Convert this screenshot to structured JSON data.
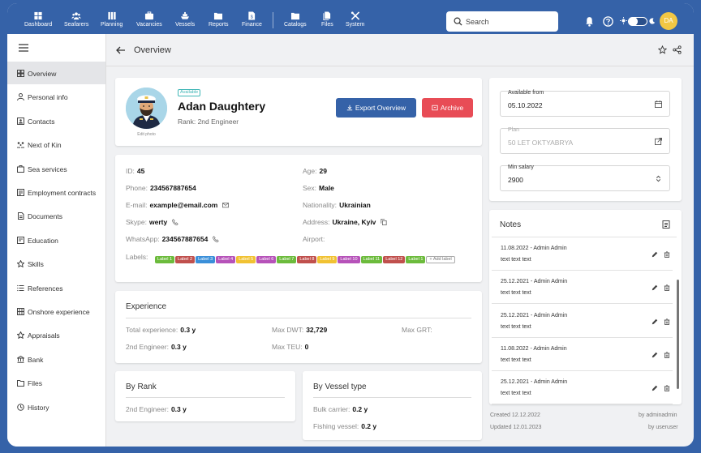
{
  "nav": [
    {
      "label": "Dashboard",
      "icon": "dashboard-icon"
    },
    {
      "label": "Seafarers",
      "icon": "people-icon"
    },
    {
      "label": "Planning",
      "icon": "planning-icon"
    },
    {
      "label": "Vacancies",
      "icon": "briefcase-icon"
    },
    {
      "label": "Vessels",
      "icon": "ship-icon"
    },
    {
      "label": "Reports",
      "icon": "reports-icon"
    },
    {
      "label": "Finance",
      "icon": "finance-icon"
    },
    {
      "label": "Catalogs",
      "icon": "folder-icon"
    },
    {
      "label": "Files",
      "icon": "files-icon"
    },
    {
      "label": "System",
      "icon": "tools-icon"
    }
  ],
  "search": {
    "placeholder": "Search"
  },
  "user": {
    "initials": "DA"
  },
  "sidebar": {
    "items": [
      {
        "label": "Overview",
        "icon": "grid-icon"
      },
      {
        "label": "Personal info",
        "icon": "person-icon"
      },
      {
        "label": "Contacts",
        "icon": "contacts-icon"
      },
      {
        "label": "Next of Kin",
        "icon": "family-icon"
      },
      {
        "label": "Sea services",
        "icon": "sea-services-icon"
      },
      {
        "label": "Employment contracts",
        "icon": "contract-icon"
      },
      {
        "label": "Documents",
        "icon": "documents-icon"
      },
      {
        "label": "Education",
        "icon": "education-icon"
      },
      {
        "label": "Skills",
        "icon": "skills-icon"
      },
      {
        "label": "References",
        "icon": "list-icon"
      },
      {
        "label": "Onshore experience",
        "icon": "building-icon"
      },
      {
        "label": "Appraisals",
        "icon": "star-icon"
      },
      {
        "label": "Bank",
        "icon": "bank-icon"
      },
      {
        "label": "Files",
        "icon": "folder-icon"
      },
      {
        "label": "History",
        "icon": "history-icon"
      }
    ]
  },
  "header": {
    "title": "Overview"
  },
  "profile": {
    "status": "Available",
    "name": "Adan Daughtery",
    "rank": "Rank: 2nd Engineer",
    "photo_caption": "Edit photo",
    "export_label": "Export Overview",
    "archive_label": "Archive"
  },
  "info": {
    "id_label": "ID:",
    "id_value": "45",
    "phone_label": "Phone:",
    "phone_value": "234567887654",
    "email_label": "E-mail:",
    "email_value": "example@email.com",
    "skype_label": "Skype:",
    "skype_value": "werty",
    "whatsapp_label": "WhatsApp:",
    "whatsapp_value": "234567887654",
    "age_label": "Age:",
    "age_value": "29",
    "sex_label": "Sex:",
    "sex_value": "Male",
    "nationality_label": "Nationality:",
    "nationality_value": "Ukrainian",
    "address_label": "Address:",
    "address_value": "Ukraine, Kyiv",
    "airport_label": "Airport:",
    "airport_value": "",
    "labels_label": "Labels:",
    "labels": [
      {
        "text": "Label 1",
        "color": "#6cbb3c"
      },
      {
        "text": "Label 2",
        "color": "#c0504d"
      },
      {
        "text": "Label 3",
        "color": "#3a8fd9"
      },
      {
        "text": "Label 4",
        "color": "#b652b9"
      },
      {
        "text": "Label 5",
        "color": "#f1c232"
      },
      {
        "text": "Label 6",
        "color": "#b652b9"
      },
      {
        "text": "Label 7",
        "color": "#6cbb3c"
      },
      {
        "text": "Label 8",
        "color": "#c0504d"
      },
      {
        "text": "Label 9",
        "color": "#f1c232"
      },
      {
        "text": "Label 10",
        "color": "#b652b9"
      },
      {
        "text": "Label 11",
        "color": "#6cbb3c"
      },
      {
        "text": "Label 12",
        "color": "#c0504d"
      },
      {
        "text": "Label 1",
        "color": "#6cbb3c"
      }
    ],
    "add_label": "+ Add label"
  },
  "experience": {
    "title": "Experience",
    "total_label": "Total experience:",
    "total_value": "0.3 y",
    "maxdwt_label": "Max DWT:",
    "maxdwt_value": "32,729",
    "maxgrt_label": "Max GRT:",
    "maxgrt_value": "",
    "rank_label": "2nd Engineer:",
    "rank_value": "0.3 y",
    "maxteu_label": "Max TEU:",
    "maxteu_value": "0"
  },
  "by_rank": {
    "title": "By Rank",
    "row_label": "2nd Engineer:",
    "row_value": "0.3 y"
  },
  "by_vessel": {
    "title": "By Vessel type",
    "row1_label": "Bulk carrier:",
    "row1_value": "0.2 y",
    "row2_label": "Fishing vessel:",
    "row2_value": "0.2 y"
  },
  "availability": {
    "from_label": "Available from",
    "from_value": "05.10.2022",
    "plan_label": "Plan",
    "plan_value": "50 LET OKTYABRYA",
    "salary_label": "Min salary",
    "salary_value": "2900"
  },
  "notes": {
    "title": "Notes",
    "items": [
      {
        "meta": "11.08.2022 - Admin Admin",
        "text": "text text text"
      },
      {
        "meta": "25.12.2021 - Admin Admin",
        "text": "text text text"
      },
      {
        "meta": "25.12.2021 - Admin Admin",
        "text": "text text text"
      },
      {
        "meta": "11.08.2022 - Admin Admin",
        "text": "text text text"
      },
      {
        "meta": "25.12.2021 - Admin Admin",
        "text": "text text text"
      }
    ]
  },
  "footer": {
    "created": "Created 12.12.2022",
    "created_by": "by adminadmin",
    "updated": "Updated 12.01.2023",
    "updated_by": "by useruser"
  },
  "colors": {
    "brand": "#3562a8",
    "danger": "#e84c56",
    "available": "#3fb6b6"
  }
}
